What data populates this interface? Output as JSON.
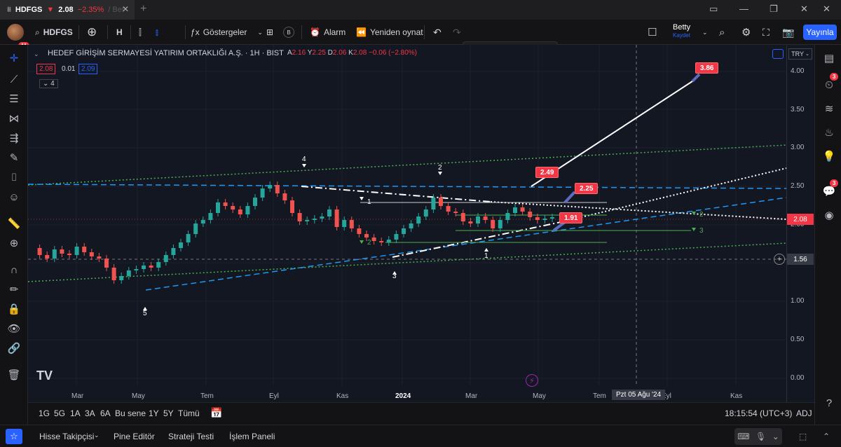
{
  "tab": {
    "symbol": "HDFGS",
    "arrow": "▼",
    "price": "2.08",
    "change": "−2.35%",
    "rest": "/ Bet"
  },
  "header": {
    "symbol": "HDFGS",
    "interval": "H",
    "indicators_label": "Göstergeler",
    "alarm_label": "Alarm",
    "replay_label": "Yeniden oynat",
    "user_name": "Betty",
    "save_label": "Kaydet",
    "publish_label": "Yayınla",
    "avatar_badge": "11",
    "b_label": "B"
  },
  "chart": {
    "title": "HEDEF GİRİŞİM SERMAYESİ YATIRIM ORTAKLIĞI A.Ş. · 1H · BIST",
    "ohlc": {
      "a_key": "A",
      "a": "2.16",
      "y_key": "Y",
      "y": "2.25",
      "d_key": "D",
      "d": "2.06",
      "k_key": "K",
      "k": "2.08",
      "chg": "−0.06 (−2.80%)"
    },
    "bid": "2.08",
    "spread": "0.01",
    "ask": "2.09",
    "indicator_count": "4",
    "currency": "TRY",
    "price_labels": [
      "4.00",
      "3.50",
      "3.00",
      "2.50",
      "2.00",
      "1.50",
      "1.00",
      "0.50",
      "0.00"
    ],
    "current_price": "2.08",
    "crosshair_price": "1.56",
    "x_labels": [
      "Mar",
      "May",
      "Tem",
      "Eyl",
      "Kas",
      "2024",
      "Mar",
      "May",
      "Tem",
      "Eyl",
      "Kas"
    ],
    "crosshair_date": "Pzt 05 Ağu '24",
    "targets": [
      "3.86",
      "2.49",
      "2.25",
      "1.91"
    ],
    "wave_labels": {
      "w5": "5",
      "w4": "4",
      "w3": "3",
      "w2": "2",
      "w1": "1",
      "a1": "1",
      "a2": "2",
      "b2": "2",
      "b3": "3",
      "c1": "1"
    },
    "accent_up": "#26a69a",
    "accent_down": "#ef5350"
  },
  "range": {
    "buttons": [
      "1G",
      "5G",
      "1A",
      "3A",
      "6A",
      "Bu sene",
      "1Y",
      "5Y",
      "Tümü"
    ],
    "time": "18:15:54 (UTC+3)",
    "adj": "ADJ"
  },
  "footer": {
    "tabs": [
      "Hisse Takipçisi",
      "Pine Editör",
      "Strateji Testi",
      "İşlem Paneli"
    ]
  },
  "right_badges": {
    "alerts": "3",
    "chat": "3"
  }
}
